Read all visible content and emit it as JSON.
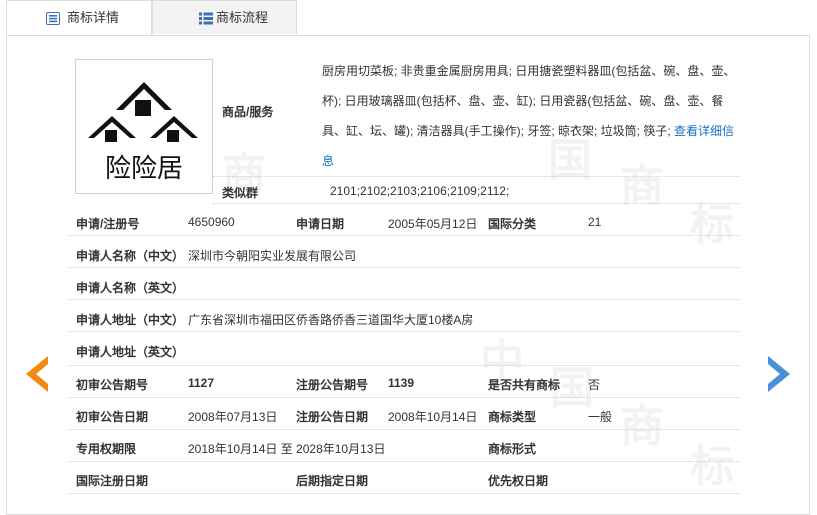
{
  "tabs": [
    {
      "label": "商标详情",
      "icon": "list-detail-icon",
      "active": true
    },
    {
      "label": "商标流程",
      "icon": "list-icon",
      "active": false
    }
  ],
  "logo": {
    "text": "险险居"
  },
  "goods": {
    "label": "商品/服务",
    "text": "厨房用切菜板; 非贵重金属厨房用具; 日用搪瓷塑料器皿(包括盆、碗、盘、壶、杯); 日用玻璃器皿(包括杯、盘、壶、缸); 日用瓷器(包括盆、碗、盘、壶、餐具、缸、坛、罐); 清洁器具(手工操作); 牙签; 晾衣架; 垃圾筒; 筷子;",
    "more_link": "查看详细信息"
  },
  "similar_group": {
    "label": "类似群",
    "value": "2101;2102;2103;2106;2109;2112;"
  },
  "reg": {
    "reg_no_label": "申请/注册号",
    "reg_no": "4650960",
    "apply_date_label": "申请日期",
    "apply_date": "2005年05月12日",
    "intl_class_label": "国际分类",
    "intl_class": "21"
  },
  "applicant_cn": {
    "label": "申请人名称（中文）",
    "value": "深圳市今朝阳实业发展有限公司"
  },
  "applicant_en": {
    "label": "申请人名称（英文）",
    "value": ""
  },
  "address_cn": {
    "label": "申请人地址（中文）",
    "value": "广东省深圳市福田区侨香路侨香三道国华大厦10楼A房"
  },
  "address_en": {
    "label": "申请人地址（英文）",
    "value": ""
  },
  "prelim": {
    "no_label": "初审公告期号",
    "no": "1127",
    "reg_no_label": "注册公告期号",
    "reg_no": "1139",
    "shared_label": "是否共有商标",
    "shared": "否"
  },
  "dates": {
    "prelim_date_label": "初审公告日期",
    "prelim_date": "2008年07月13日",
    "reg_date_label": "注册公告日期",
    "reg_date": "2008年10月14日",
    "type_label": "商标类型",
    "type": "一般"
  },
  "rights": {
    "label": "专用权期限",
    "value": "2018年10月14日 至 2028年10月13日",
    "form_label": "商标形式",
    "form": ""
  },
  "intl": {
    "intl_reg_label": "国际注册日期",
    "later_label": "后期指定日期",
    "priority_label": "优先权日期"
  },
  "colors": {
    "accent_orange": "#f08a14",
    "accent_blue": "#4a90d9",
    "link": "#1a6fc9"
  }
}
